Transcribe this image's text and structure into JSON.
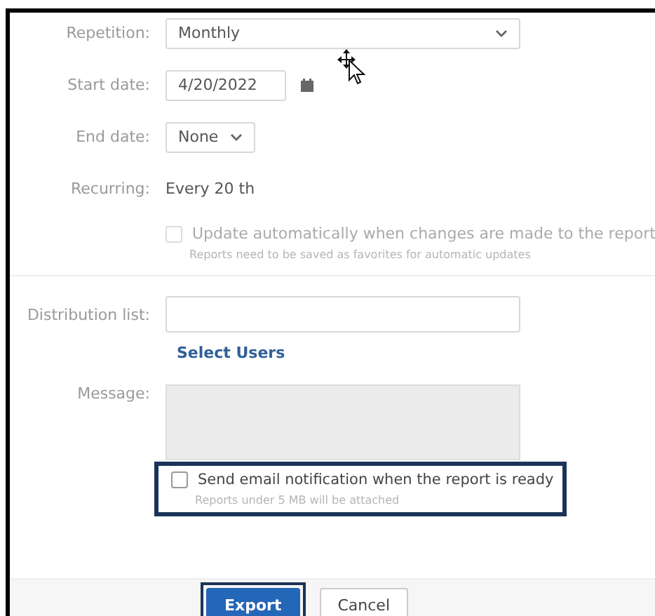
{
  "repetition": {
    "label": "Repetition:",
    "value": "Monthly"
  },
  "start_date": {
    "label": "Start date:",
    "value": "4/20/2022"
  },
  "end_date": {
    "label": "End date:",
    "value": "None"
  },
  "recurring": {
    "label": "Recurring:",
    "value": "Every 20 th"
  },
  "auto_update": {
    "label": "Update automatically when changes are made to the report",
    "hint": "Reports need to be saved as favorites for automatic updates",
    "checked": false,
    "disabled": true
  },
  "distribution_list": {
    "label": "Distribution list:",
    "link": "Select Users"
  },
  "message": {
    "label": "Message:",
    "disabled": true
  },
  "email_notification": {
    "label": "Send email notification when the report is ready",
    "hint": "Reports under 5 MB will be attached",
    "checked": false,
    "highlighted": true
  },
  "buttons": [
    {
      "label": "Export",
      "kind": "primary",
      "highlighted": true
    },
    {
      "label": "Cancel",
      "kind": "secondary",
      "highlighted": false
    }
  ]
}
